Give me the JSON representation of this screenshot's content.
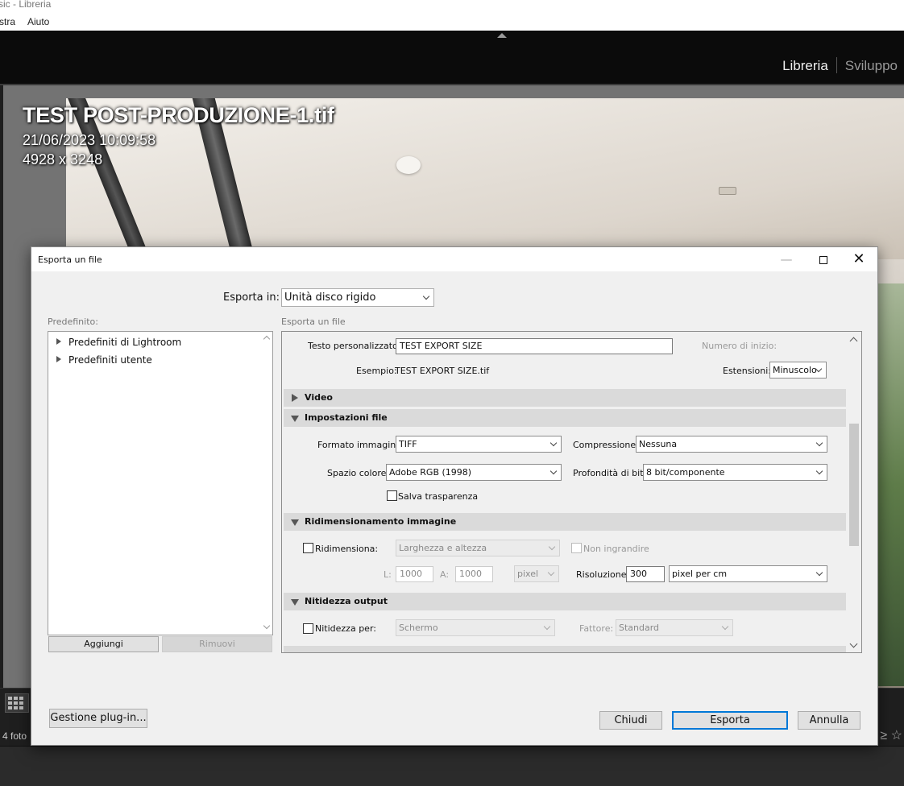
{
  "window": {
    "title_fragment": "sic - Libreria"
  },
  "menubar": {
    "items": [
      "stra",
      "Aiuto"
    ]
  },
  "lightroom": {
    "modules": {
      "active": "Libreria",
      "other": "Sviluppo"
    },
    "photo": {
      "filename": "TEST POST-PRODUZIONE-1.tif",
      "datetime": "21/06/2023 10:09:58",
      "dimensions": "4928 x 3248"
    },
    "bottom": {
      "photo_count": "4 foto",
      "right_symbols": "≥ ☆"
    }
  },
  "dialog": {
    "title": "Esporta un file",
    "window_buttons": {
      "minimize": "—",
      "close": "✕"
    },
    "export_to": {
      "label": "Esporta in:",
      "value": "Unità disco rigido"
    },
    "presets": {
      "label": "Predefinito:",
      "items": [
        "Predefiniti di Lightroom",
        "Predefiniti utente"
      ],
      "add_label": "Aggiungi",
      "remove_label": "Rimuovi"
    },
    "panel_label": "Esporta un file",
    "naming": {
      "custom_text_label": "Testo personalizzato:",
      "custom_text_value": "TEST EXPORT SIZE",
      "start_number_label": "Numero di inizio:",
      "example_label": "Esempio:",
      "example_value": "TEST EXPORT SIZE.tif",
      "extensions_label": "Estensioni:",
      "extensions_value": "Minuscolo"
    },
    "sections": {
      "video": "Video",
      "file_settings": "Impostazioni file",
      "resize": "Ridimensionamento immagine",
      "sharpening": "Nitidezza output"
    },
    "file_settings": {
      "format_label": "Formato immagine:",
      "format_value": "TIFF",
      "compression_label": "Compressione:",
      "compression_value": "Nessuna",
      "color_space_label": "Spazio colore:",
      "color_space_value": "Adobe RGB (1998)",
      "bit_depth_label": "Profondità di bit:",
      "bit_depth_value": "8 bit/componente",
      "save_transparency_label": "Salva trasparenza"
    },
    "resize": {
      "resize_label": "Ridimensiona:",
      "mode_value": "Larghezza e altezza",
      "dont_enlarge_label": "Non ingrandire",
      "width_label": "L:",
      "width_value": "1000",
      "height_label": "A:",
      "height_value": "1000",
      "unit_value": "pixel",
      "resolution_label": "Risoluzione:",
      "resolution_value": "300",
      "resolution_unit_value": "pixel per cm"
    },
    "sharpening": {
      "sharpen_label": "Nitidezza per:",
      "target_value": "Schermo",
      "amount_label": "Fattore:",
      "amount_value": "Standard"
    },
    "plugin_button": "Gestione plug-in...",
    "buttons": {
      "close": "Chiudi",
      "export": "Esporta",
      "cancel": "Annulla"
    }
  },
  "colors": {
    "lr_dark": "#0b0b0b",
    "dialog_bg": "#f0f0f0",
    "accent": "#0078d7"
  }
}
